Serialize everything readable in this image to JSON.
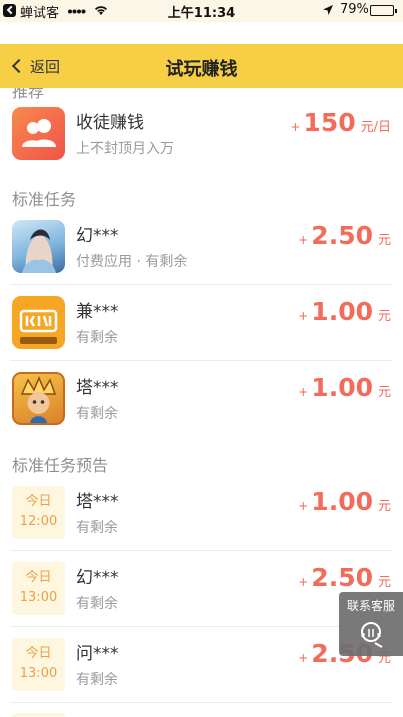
{
  "status_bar": {
    "carrier": "蝉试客",
    "time": "上午11:34",
    "battery": "79%"
  },
  "nav": {
    "back_label": "返回",
    "title": "试玩赚钱"
  },
  "cut_section": "推荐",
  "recruit": {
    "name": "收徒赚钱",
    "desc": "上不封顶月入万",
    "plus": "+",
    "amount": "150",
    "unit": "元/日"
  },
  "standard": {
    "header": "标准任务",
    "items": [
      {
        "name": "幻***",
        "desc": "付费应用 · 有剩余",
        "plus": "+",
        "amount": "2.50",
        "unit": "元",
        "icon": "game-icon-huan"
      },
      {
        "name": "兼***",
        "desc": "有剩余",
        "plus": "+",
        "amount": "1.00",
        "unit": "元",
        "icon": "app-icon-jian"
      },
      {
        "name": "塔***",
        "desc": "有剩余",
        "plus": "+",
        "amount": "1.00",
        "unit": "元",
        "icon": "game-icon-ta"
      }
    ]
  },
  "preview": {
    "header": "标准任务预告",
    "items": [
      {
        "day": "今日",
        "time": "12:00",
        "name": "塔***",
        "desc": "有剩余",
        "plus": "+",
        "amount": "1.00",
        "unit": "元"
      },
      {
        "day": "今日",
        "time": "13:00",
        "name": "幻***",
        "desc": "有剩余",
        "plus": "+",
        "amount": "2.50",
        "unit": "元"
      },
      {
        "day": "今日",
        "time": "13:00",
        "name": "问***",
        "desc": "有剩余",
        "plus": "+",
        "amount": "2.50",
        "unit": "元"
      }
    ]
  },
  "service": {
    "label": "联系客服"
  },
  "colors": {
    "accent": "#f7cf45",
    "price": "#f26b5b",
    "date": "#e8a24a"
  }
}
